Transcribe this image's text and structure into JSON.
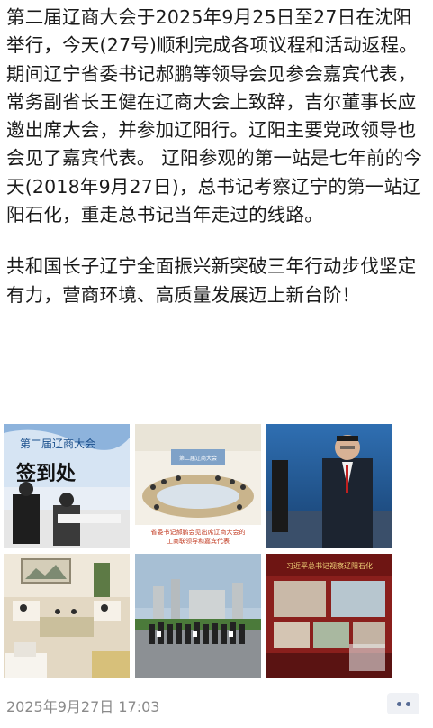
{
  "post": {
    "paragraph1": "第二届辽商大会于2025年9月25日至27日在沈阳举行，今天(27号)顺利完成各项议程和活动返程。期间辽宁省委书记郝鹏等领导会见参会嘉宾代表，常务副省长王健在辽商大会上致辞，吉尔董事长应邀出席大会，并参加辽阳行。辽阳主要党政领导也会见了嘉宾代表。 辽阳参观的第一站是七年前的今天(2018年9月27日)，总书记考察辽宁的第一站辽阳石化，重走总书记当年走过的线路。",
    "paragraph2": "共和国长子辽宁全面振兴新突破三年行动步伐坚定有力，营商环境、高质量发展迈上新台阶！"
  },
  "photos": {
    "photo1_sign_top": "第二届辽商大会",
    "photo1_sign_bottom": "签到处",
    "photo2_caption_line1": "省委书记郝鹏会见出席辽商大会的",
    "photo2_caption_line2": "工商联领导和嘉宾代表",
    "photo2_banner": "第二届辽商大会",
    "photo6_banner": "习近平总书记视察辽阳石化"
  },
  "meta": {
    "timestamp": "2025年9月27日 17:03",
    "more_icon": "more-dots-icon"
  },
  "colors": {
    "text": "#1a1a1a",
    "timestamp": "#8a8a8a",
    "link_blue": "#576b95",
    "button_bg": "#eff1f5"
  }
}
